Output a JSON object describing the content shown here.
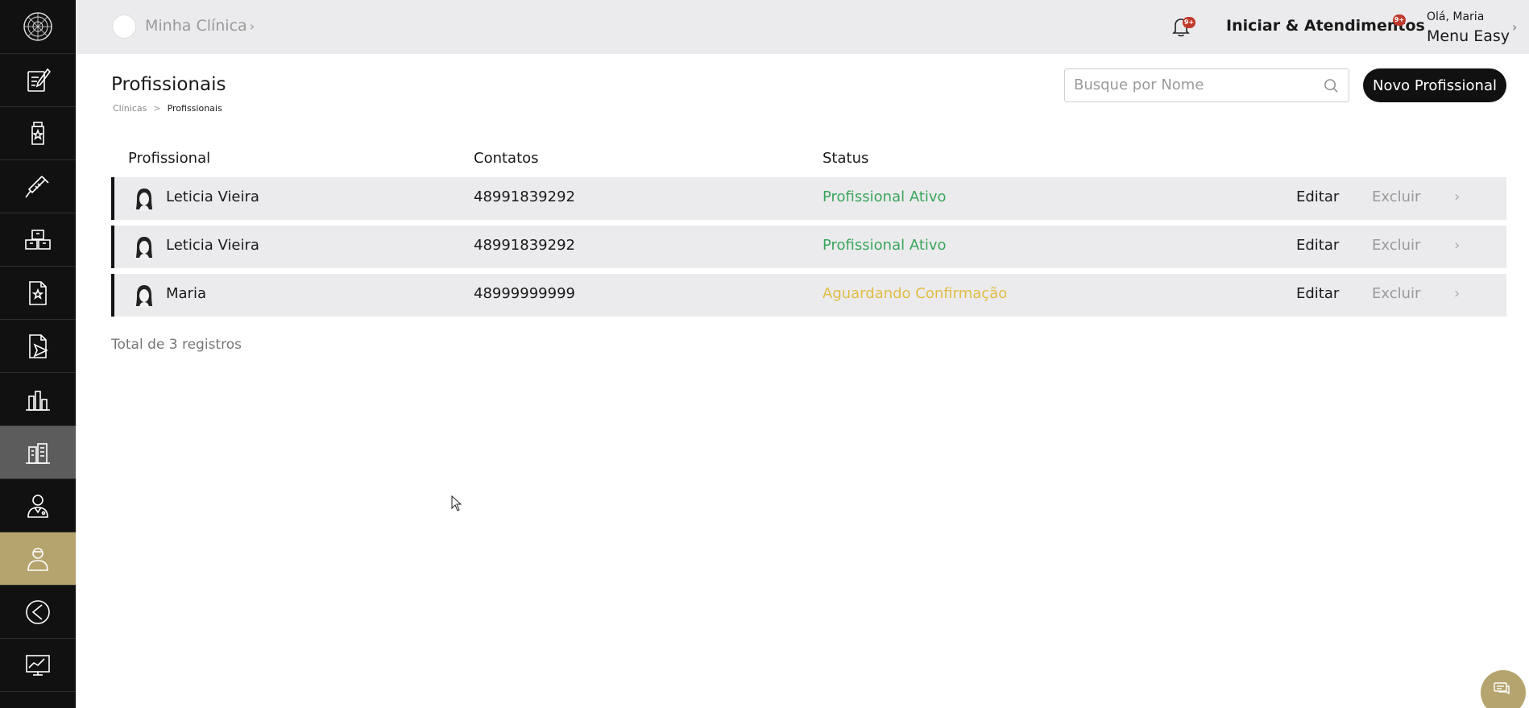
{
  "topbar": {
    "clinic_name": "Minha Clínica",
    "clinic_chevron": "›",
    "notifications_badge": "9+",
    "iniciar_label": "Iniciar & Atendimentos",
    "iniciar_badge": "9+",
    "user_greeting": "Olá, Maria",
    "user_menu_label": "Menu Easy",
    "user_chevron": "›"
  },
  "sidebar": {
    "items": [
      {
        "icon": "edit-document-icon"
      },
      {
        "icon": "medicine-bottle-icon"
      },
      {
        "icon": "syringe-icon"
      },
      {
        "icon": "boxes-icon"
      },
      {
        "icon": "document-star-icon"
      },
      {
        "icon": "document-send-icon"
      },
      {
        "icon": "bar-chart-icon"
      },
      {
        "icon": "buildings-icon"
      },
      {
        "icon": "doctor-icon"
      },
      {
        "icon": "professional-icon"
      },
      {
        "icon": "back-arrow-icon"
      },
      {
        "icon": "finance-chart-icon"
      }
    ]
  },
  "page": {
    "title": "Profissionais",
    "breadcrumb": {
      "parent": "Clínicas",
      "separator": ">",
      "current": "Profissionais"
    },
    "search_placeholder": "Busque por Nome",
    "new_button": "Novo Profissional"
  },
  "table": {
    "headers": {
      "professional": "Profissional",
      "contacts": "Contatos",
      "status": "Status"
    },
    "rows": [
      {
        "name": "Leticia Vieira",
        "contact": "48991839292",
        "status": "Profissional Ativo",
        "edit": "Editar",
        "delete": "Excluir",
        "chevron": "›"
      },
      {
        "name": "Leticia Vieira",
        "contact": "48991839292",
        "status": "Profissional Ativo",
        "edit": "Editar",
        "delete": "Excluir",
        "chevron": "›"
      },
      {
        "name": "Maria",
        "contact": "48999999999",
        "status": "Aguardando Confirmação",
        "edit": "Editar",
        "delete": "Excluir",
        "chevron": "›"
      }
    ],
    "total": "Total de 3 registros"
  },
  "colors": {
    "sidebar_bg": "#111111",
    "active_gold": "#b5a46e",
    "status_active": "#3aa65a",
    "status_pending": "#e1bd45",
    "topbar_bg": "#ebebee"
  }
}
